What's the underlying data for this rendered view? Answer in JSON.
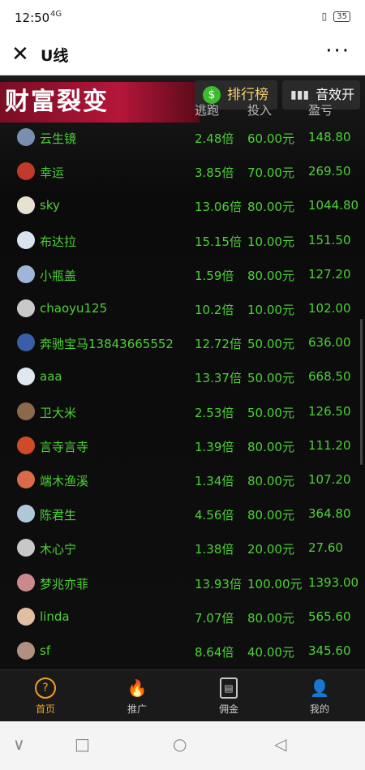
{
  "status": {
    "time": "12:50",
    "signal": "4G",
    "battery": "35"
  },
  "window": {
    "title": "U线",
    "close_glyph": "✕",
    "more_glyph": "···"
  },
  "banner": {
    "text": "财富裂变"
  },
  "buttons": {
    "rank_label": "排行榜",
    "rank_coin": "$",
    "sound_label": "音效开"
  },
  "columns": [
    "逃跑",
    "投入",
    "盈亏"
  ],
  "rows": [
    {
      "name": "云生镜",
      "rate": "2.48倍",
      "invest": "60.00元",
      "profit": "148.80",
      "avatar_color": "#7a8fb0"
    },
    {
      "name": "幸运",
      "rate": "3.85倍",
      "invest": "70.00元",
      "profit": "269.50",
      "avatar_color": "#c0392b"
    },
    {
      "name": "sky",
      "rate": "13.06倍",
      "invest": "80.00元",
      "profit": "1044.80",
      "avatar_color": "#e8e0d0"
    },
    {
      "name": "布达拉",
      "rate": "15.15倍",
      "invest": "10.00元",
      "profit": "151.50",
      "avatar_color": "#d9e4f0"
    },
    {
      "name": "小瓶盖",
      "rate": "1.59倍",
      "invest": "80.00元",
      "profit": "127.20",
      "avatar_color": "#9fb6d8"
    },
    {
      "name": "chaoyu125",
      "rate": "10.2倍",
      "invest": "10.00元",
      "profit": "102.00",
      "avatar_color": "#c9c9c9"
    },
    {
      "name": "奔驰宝马13843665552",
      "rate": "12.72倍",
      "invest": "50.00元",
      "profit": "636.00",
      "avatar_color": "#3a5fa8"
    },
    {
      "name": "aaa",
      "rate": "13.37倍",
      "invest": "50.00元",
      "profit": "668.50",
      "avatar_color": "#dfe8ee"
    },
    {
      "name": "卫大米",
      "rate": "2.53倍",
      "invest": "50.00元",
      "profit": "126.50",
      "avatar_color": "#8a6a4a"
    },
    {
      "name": "言寺言寺",
      "rate": "1.39倍",
      "invest": "80.00元",
      "profit": "111.20",
      "avatar_color": "#d04a2a"
    },
    {
      "name": "端木渔溪",
      "rate": "1.34倍",
      "invest": "80.00元",
      "profit": "107.20",
      "avatar_color": "#d96a4a"
    },
    {
      "name": "陈君生",
      "rate": "4.56倍",
      "invest": "80.00元",
      "profit": "364.80",
      "avatar_color": "#b0c8d8"
    },
    {
      "name": "木心宁",
      "rate": "1.38倍",
      "invest": "20.00元",
      "profit": "27.60",
      "avatar_color": "#c8c8c8"
    },
    {
      "name": "梦兆亦菲",
      "rate": "13.93倍",
      "invest": "100.00元",
      "profit": "1393.00",
      "avatar_color": "#c88a8a"
    },
    {
      "name": "linda",
      "rate": "7.07倍",
      "invest": "80.00元",
      "profit": "565.60",
      "avatar_color": "#e0c0a0"
    },
    {
      "name": "sf",
      "rate": "8.64倍",
      "invest": "40.00元",
      "profit": "345.60",
      "avatar_color": "#b09080"
    }
  ],
  "tabs": [
    {
      "label": "首页",
      "icon": "?"
    },
    {
      "label": "推广",
      "icon": "🔥"
    },
    {
      "label": "佣金",
      "icon": "▤"
    },
    {
      "label": "我的",
      "icon": "👤"
    }
  ],
  "navbar": {
    "back": "∨",
    "home": "□",
    "circle": "○",
    "recent": "◁"
  },
  "colors": {
    "accent": "#f0a020",
    "value_green": "#4cd136",
    "banner_red": "#b5163a"
  }
}
